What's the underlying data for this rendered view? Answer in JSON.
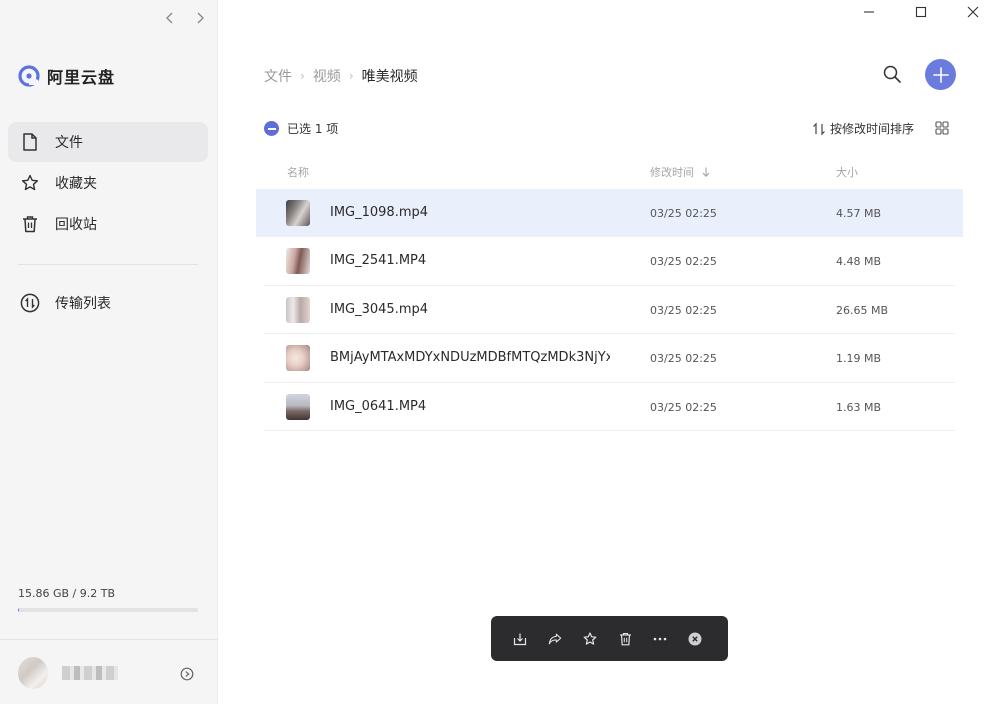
{
  "app": {
    "name": "阿里云盘"
  },
  "sidebar": {
    "items": [
      {
        "label": "文件",
        "icon": "file-icon",
        "active": true
      },
      {
        "label": "收藏夹",
        "icon": "star-icon",
        "active": false
      },
      {
        "label": "回收站",
        "icon": "trash-icon",
        "active": false
      }
    ],
    "transfer": {
      "label": "传输列表",
      "icon": "transfer-icon"
    },
    "storage": {
      "text": "15.86 GB / 9.2 TB",
      "used_fraction": 0.0017
    }
  },
  "breadcrumb": [
    "文件",
    "视频",
    "唯美视频"
  ],
  "toolbar": {
    "selection_text": "已选 1 项",
    "sort_label": "按修改时间排序"
  },
  "table": {
    "columns": {
      "name": "名称",
      "time": "修改时间",
      "size": "大小"
    },
    "rows": [
      {
        "name": "IMG_1098.mp4",
        "time": "03/25 02:25",
        "size": "4.57 MB",
        "selected": true
      },
      {
        "name": "IMG_2541.MP4",
        "time": "03/25 02:25",
        "size": "4.48 MB",
        "selected": false
      },
      {
        "name": "IMG_3045.mp4",
        "time": "03/25 02:25",
        "size": "26.65 MB",
        "selected": false
      },
      {
        "name": "BMjAyMTAxMDYxNDUzMDBfMTQzMDk3NjYx...",
        "time": "03/25 02:25",
        "size": "1.19 MB",
        "selected": false
      },
      {
        "name": "IMG_0641.MP4",
        "time": "03/25 02:25",
        "size": "1.63 MB",
        "selected": false
      }
    ]
  },
  "actionbar": [
    "download-icon",
    "share-icon",
    "favorite-icon",
    "delete-icon",
    "more-icon",
    "close-icon"
  ],
  "colors": {
    "accent": "#6b7bde",
    "selected_row": "#eaeffc",
    "actionbar": "#2c2c2e"
  }
}
